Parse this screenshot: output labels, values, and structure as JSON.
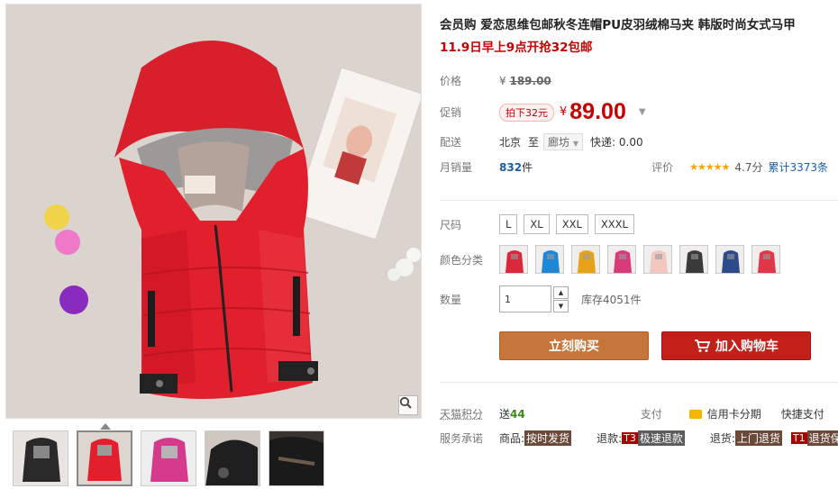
{
  "product": {
    "title": "会员购 爱恋思维包邮秋冬连帽PU皮羽绒棉马夹 韩版时尚女式马甲",
    "promo": "11.9日早上9点开抢32包邮"
  },
  "price": {
    "label": "价格",
    "currency": "¥",
    "original": "189.00",
    "promo_label": "促销",
    "discount_badge": "拍下32元",
    "current": "89.00"
  },
  "shipping": {
    "label": "配送",
    "from": "北京",
    "to_word": "至",
    "destination": "廊坊",
    "express": "快递: 0.00"
  },
  "sales": {
    "label": "月销量",
    "count": "832",
    "unit": "件",
    "rating_label": "评价",
    "stars": "★★★★★",
    "rating_score": "4.7分",
    "review_text": "累计3373条"
  },
  "size": {
    "label": "尺码",
    "options": [
      "L",
      "XL",
      "XXL",
      "XXXL"
    ]
  },
  "color": {
    "label": "颜色分类",
    "swatches": [
      "#d9283a",
      "#1e88d6",
      "#e8a21a",
      "#d83a7a",
      "#f3c6c0",
      "#3a3a3a",
      "#2d4a8a",
      "#e0384a"
    ]
  },
  "quantity": {
    "label": "数量",
    "value": "1",
    "stock": "库存4051件"
  },
  "actions": {
    "buy_now": "立刻购买",
    "add_cart": "加入购物车"
  },
  "points": {
    "label": "天猫积分",
    "prefix": "送",
    "value": "44",
    "pay_label": "支付",
    "credit": "信用卡分期",
    "quickpay": "快捷支付"
  },
  "service": {
    "label": "服务承诺",
    "goods": "商品:",
    "goods_tag": "按时发货",
    "refund": "退款:",
    "refund_t": "T3",
    "refund_tag": "极速退款",
    "return": "退货:",
    "return_tag": "上门退货",
    "guarantee_t": "T1",
    "guarantee_tag": "退货保障"
  },
  "colors": {
    "price_red": "#c40000",
    "buy_btn": "#c6763b",
    "cart_btn": "#c4201a",
    "link_blue": "#1b5fa6"
  }
}
